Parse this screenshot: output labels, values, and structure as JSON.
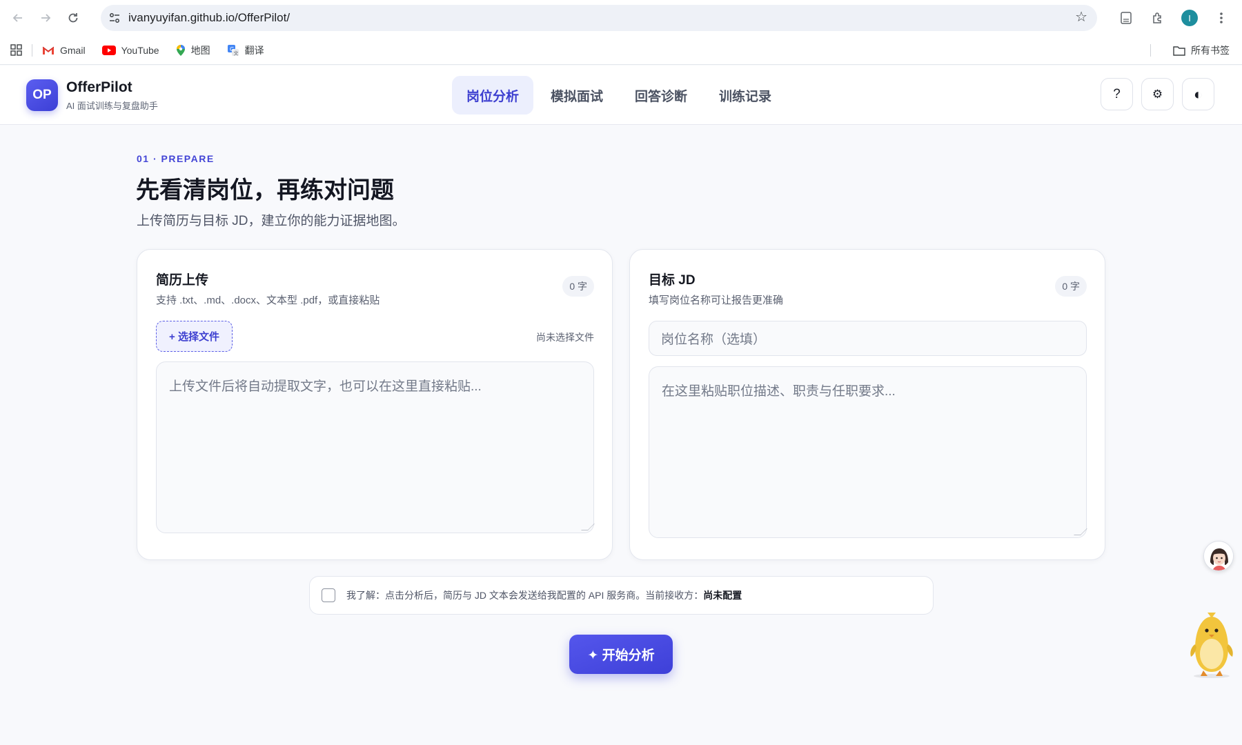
{
  "browser": {
    "url": "ivanyuyifan.github.io/OfferPilot/",
    "profile_initial": "I",
    "bookmarks": [
      {
        "label": "Gmail",
        "icon": "gmail-icon"
      },
      {
        "label": "YouTube",
        "icon": "youtube-icon"
      },
      {
        "label": "地图",
        "icon": "maps-icon"
      },
      {
        "label": "翻译",
        "icon": "translate-icon"
      }
    ],
    "all_bookmarks": "所有书签"
  },
  "app": {
    "logo": "OP",
    "name": "OfferPilot",
    "tagline": "AI 面试训练与复盘助手",
    "tabs": [
      {
        "label": "岗位分析",
        "active": true
      },
      {
        "label": "模拟面试",
        "active": false
      },
      {
        "label": "回答诊断",
        "active": false
      },
      {
        "label": "训练记录",
        "active": false
      }
    ],
    "header_buttons": {
      "help": "?",
      "settings": "⚙",
      "theme": "◐"
    },
    "accent": "#4345d6"
  },
  "page": {
    "eyebrow": "01 · PREPARE",
    "title": "先看清岗位，再练对问题",
    "description": "上传简历与目标 JD，建立你的能力证据地图。"
  },
  "resume_card": {
    "title": "简历上传",
    "subtitle": "支持 .txt、.md、.docx、文本型 .pdf，或直接粘贴",
    "count": "0 字",
    "file_button": "+ 选择文件",
    "file_status": "尚未选择文件",
    "textarea_placeholder": "上传文件后将自动提取文字，也可以在这里直接粘贴..."
  },
  "jd_card": {
    "title": "目标 JD",
    "subtitle": "填写岗位名称可让报告更准确",
    "count": "0 字",
    "role_placeholder": "岗位名称（选填）",
    "textarea_placeholder": "在这里粘贴职位描述、职责与任职要求..."
  },
  "consent": {
    "text": "我了解：点击分析后，简历与 JD 文本会发送给我配置的 API 服务商。当前接收方：",
    "receiver": "尚未配置",
    "checked": false
  },
  "start_button": "✦ 开始分析"
}
